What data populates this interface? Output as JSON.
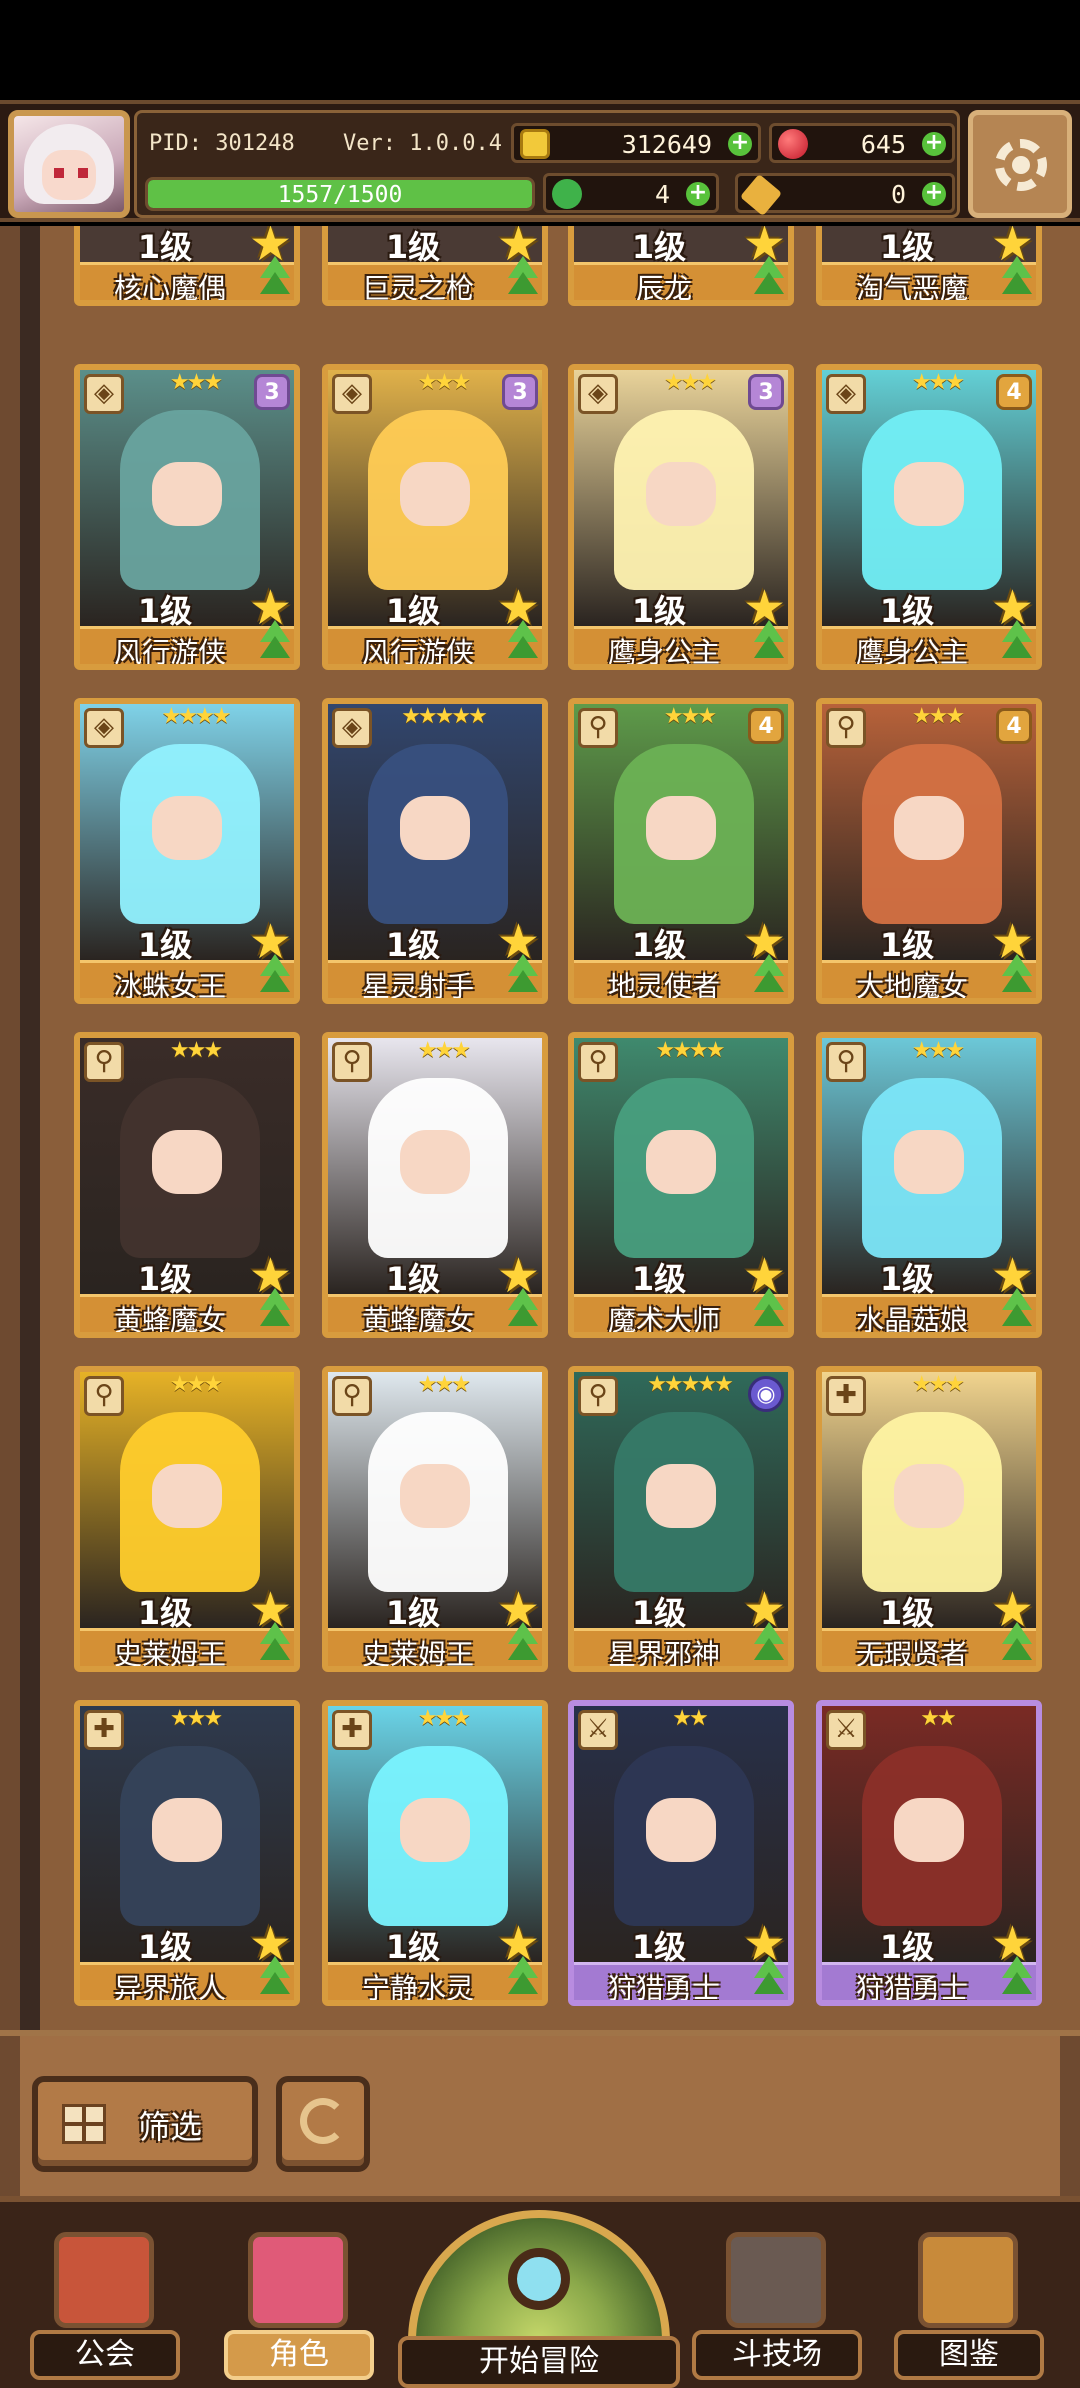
{
  "hud": {
    "pid": "PID: 301248",
    "version": "Ver: 1.0.0.4",
    "gold": "312649",
    "ruby": "645",
    "xp_text": "1557/1500",
    "xp_fraction": 1.0,
    "clover": "4",
    "scroll": "0"
  },
  "partial_cards": [
    {
      "level": "1级",
      "name": "核心魔偶"
    },
    {
      "level": "1级",
      "name": "巨灵之枪"
    },
    {
      "level": "1级",
      "name": "辰龙"
    },
    {
      "level": "1级",
      "name": "淘气恶魔"
    }
  ],
  "cards": [
    {
      "level": "1级",
      "name": "风行游侠",
      "stars": "★★★",
      "rank": "3",
      "type_icon": "shield-icon",
      "frame": "gold",
      "color": "#5b8f8a"
    },
    {
      "level": "1级",
      "name": "风行游侠",
      "stars": "★★★",
      "rank": "3",
      "type_icon": "shield-icon",
      "frame": "gold",
      "color": "#e0b14a"
    },
    {
      "level": "1级",
      "name": "鹰身公主",
      "stars": "★★★",
      "rank": "3",
      "type_icon": "shield-icon",
      "frame": "gold",
      "color": "#e9d39a"
    },
    {
      "level": "1级",
      "name": "鹰身公主",
      "stars": "★★★",
      "rank": "4",
      "type_icon": "shield-icon",
      "frame": "gold",
      "color": "#63d0d6"
    },
    {
      "level": "1级",
      "name": "冰蛛女王",
      "stars": "★★★★",
      "rank": "",
      "type_icon": "shield-icon",
      "frame": "gold",
      "color": "#7fd2e8"
    },
    {
      "level": "1级",
      "name": "星灵射手",
      "stars": "★★★★★",
      "rank": "",
      "type_icon": "shield-icon",
      "frame": "gold",
      "color": "#31466e"
    },
    {
      "level": "1级",
      "name": "地灵使者",
      "stars": "★★★",
      "rank": "4",
      "type_icon": "wand-icon",
      "frame": "gold",
      "color": "#5e9b4a"
    },
    {
      "level": "1级",
      "name": "大地魔女",
      "stars": "★★★",
      "rank": "4",
      "type_icon": "wand-icon",
      "frame": "gold",
      "color": "#b8623a"
    },
    {
      "level": "1级",
      "name": "黄蜂魔女",
      "stars": "★★★",
      "rank": "",
      "type_icon": "wand-icon",
      "frame": "gold",
      "color": "#3a2c28"
    },
    {
      "level": "1级",
      "name": "黄蜂魔女",
      "stars": "★★★",
      "rank": "",
      "type_icon": "wand-icon",
      "frame": "gold",
      "color": "#e8e6ee"
    },
    {
      "level": "1级",
      "name": "魔术大师",
      "stars": "★★★★",
      "rank": "",
      "type_icon": "wand-icon",
      "frame": "gold",
      "color": "#3f8a6e"
    },
    {
      "level": "1级",
      "name": "水晶菇娘",
      "stars": "★★★",
      "rank": "",
      "type_icon": "wand-icon",
      "frame": "gold",
      "color": "#6cc8d8"
    },
    {
      "level": "1级",
      "name": "史莱姆王",
      "stars": "★★★",
      "rank": "",
      "type_icon": "wand-icon",
      "frame": "gold",
      "color": "#e6b226"
    },
    {
      "level": "1级",
      "name": "史莱姆王",
      "stars": "★★★",
      "rank": "",
      "type_icon": "wand-icon",
      "frame": "gold",
      "color": "#dfe8ee"
    },
    {
      "level": "1级",
      "name": "星界邪神",
      "stars": "★★★★★",
      "rank": "◉",
      "type_icon": "wand-icon",
      "frame": "gold",
      "color": "#2f6a5a"
    },
    {
      "level": "1级",
      "name": "无瑕贤者",
      "stars": "★★★",
      "rank": "",
      "type_icon": "cross-icon",
      "frame": "gold",
      "color": "#f1d48e"
    },
    {
      "level": "1级",
      "name": "异界旅人",
      "stars": "★★★",
      "rank": "",
      "type_icon": "cross-icon",
      "frame": "gold",
      "color": "#2e3a4e"
    },
    {
      "level": "1级",
      "name": "宁静水灵",
      "stars": "★★★",
      "rank": "",
      "type_icon": "cross-icon",
      "frame": "gold",
      "color": "#6ad4e8"
    },
    {
      "level": "1级",
      "name": "狩猎勇士",
      "stars": "★★",
      "rank": "",
      "type_icon": "sword-icon",
      "frame": "purple",
      "color": "#28304a"
    },
    {
      "level": "1级",
      "name": "狩猎勇士",
      "stars": "★★",
      "rank": "",
      "type_icon": "sword-icon",
      "frame": "purple",
      "color": "#7a2a24"
    }
  ],
  "filter": {
    "label": "筛选"
  },
  "nav": {
    "guild": "公会",
    "character": "角色",
    "start": "开始冒险",
    "arena": "斗技场",
    "codex": "图鉴"
  }
}
